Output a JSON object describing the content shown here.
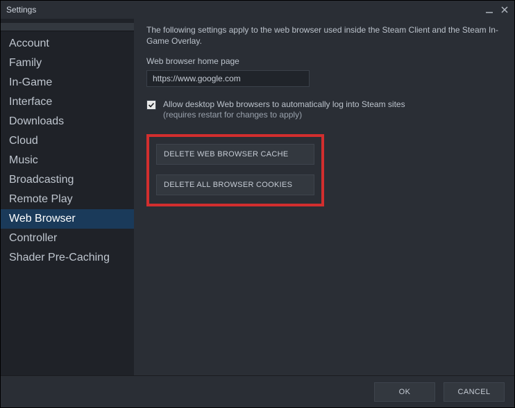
{
  "window": {
    "title": "Settings"
  },
  "sidebar": {
    "items": [
      {
        "label": "Account"
      },
      {
        "label": "Family"
      },
      {
        "label": "In-Game"
      },
      {
        "label": "Interface"
      },
      {
        "label": "Downloads"
      },
      {
        "label": "Cloud"
      },
      {
        "label": "Music"
      },
      {
        "label": "Broadcasting"
      },
      {
        "label": "Remote Play"
      },
      {
        "label": "Web Browser"
      },
      {
        "label": "Controller"
      },
      {
        "label": "Shader Pre-Caching"
      }
    ],
    "selected_index": 9
  },
  "main": {
    "description": "The following settings apply to the web browser used inside the Steam Client and the Steam In-Game Overlay.",
    "homepage_label": "Web browser home page",
    "homepage_value": "https://www.google.com",
    "auto_login": {
      "checked": true,
      "text": "Allow desktop Web browsers to automatically log into Steam sites",
      "subtext": "(requires restart for changes to apply)"
    },
    "buttons": {
      "delete_cache": "DELETE WEB BROWSER CACHE",
      "delete_cookies": "DELETE ALL BROWSER COOKIES"
    }
  },
  "footer": {
    "ok": "OK",
    "cancel": "CANCEL"
  },
  "colors": {
    "highlight_border": "#d22e2e",
    "accent_selected": "#1a3a5a"
  }
}
